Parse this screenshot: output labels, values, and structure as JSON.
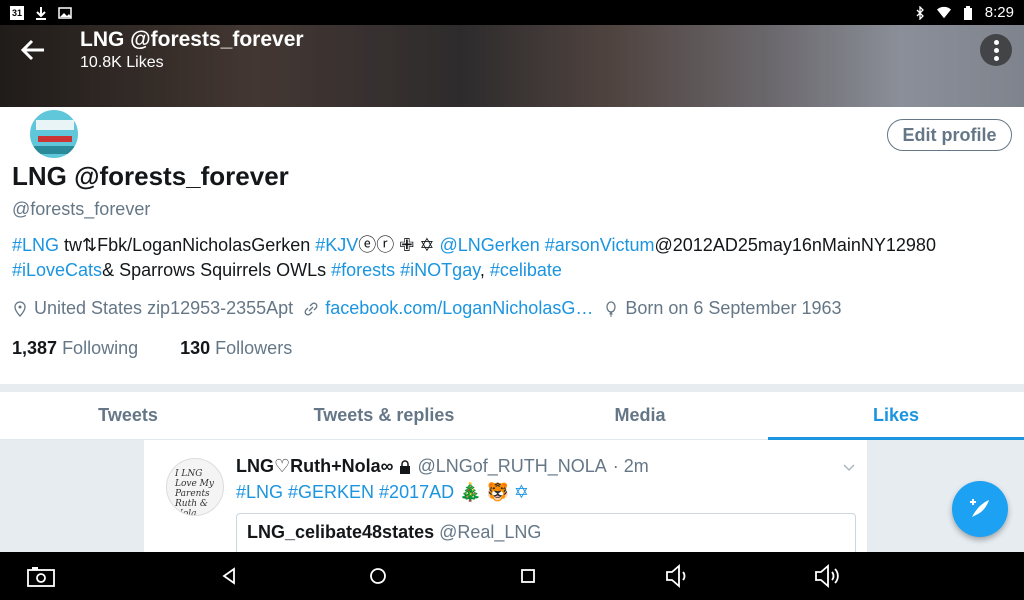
{
  "status_bar": {
    "time": "8:29",
    "calendar_day": "31",
    "left_icons": [
      "calendar-icon",
      "download-icon",
      "image-icon"
    ],
    "right_icons": [
      "bluetooth-icon",
      "wifi-icon",
      "battery-icon"
    ]
  },
  "header": {
    "title": "LNG @forests_forever",
    "subtitle": "10.8K Likes"
  },
  "profile": {
    "edit_label": "Edit profile",
    "name": "LNG @forests_forever",
    "handle": "@forests_forever",
    "bio": {
      "tag_lng": "#LNG",
      "text1": " tw⇅Fbk/LoganNicholasGerken ",
      "tag_kjv": "#KJV",
      "symbols": "ⓔⓡ ✙ ✡ ",
      "mention": "@LNGerken",
      "text2": " ",
      "tag_arson": "#arsonVictum",
      "text3": "@2012AD25may16nMainNY12980",
      "tag_cats": "#iLoveCats",
      "text4": "& Sparrows Squirrels OWLs ",
      "tag_forests": "#forests",
      "text5": " ",
      "tag_gay": "#iNOTgay",
      "text6": ", ",
      "tag_celibate": "#celibate"
    },
    "location": "United States zip12953-2355Apt",
    "website": "facebook.com/LoganNicholasG…",
    "born": "Born on 6 September 1963",
    "following_count": "1,387",
    "following_label": "Following",
    "followers_count": "130",
    "followers_label": "Followers"
  },
  "tabs": [
    {
      "label": "Tweets",
      "active": false
    },
    {
      "label": "Tweets & replies",
      "active": false
    },
    {
      "label": "Media",
      "active": false
    },
    {
      "label": "Likes",
      "active": true
    }
  ],
  "tweet": {
    "name": "LNG♡Ruth+Nola∞",
    "handle": "@LNGof_RUTH_NOLA",
    "time": "· 2m",
    "text": "#LNG #GERKEN #2017AD 🎄 🐯 ✡",
    "avatar_text": "I LNG Love My Parents Ruth & Nola",
    "quote_name": "LNG_celibate48states",
    "quote_handle": "@Real_LNG"
  },
  "colors": {
    "accent": "#1b95e0",
    "secondary_text": "#657786",
    "fab": "#1da1f2"
  }
}
